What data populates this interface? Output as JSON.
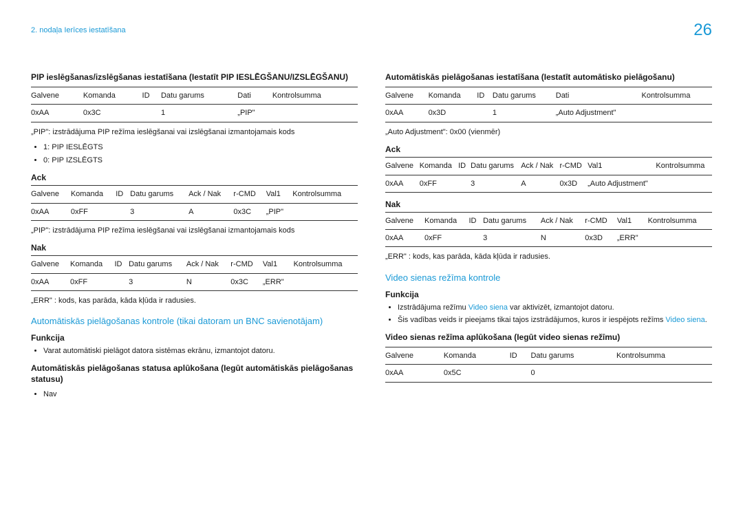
{
  "header": {
    "breadcrumb": "2. nodaļa Ierīces iestatīšana",
    "page": "26"
  },
  "left": {
    "sec1_title": "PIP ieslēgšanas/izslēgšanas iestatīšana (Iestatīt PIP IESLĒGŠANU/IZSLĒGŠANU)",
    "t1": {
      "h": [
        "Galvene",
        "Komanda",
        "ID",
        "Datu garums",
        "Dati",
        "Kontrolsumma"
      ],
      "r": [
        "0xAA",
        "0x3C",
        "",
        "1",
        "„PIP\"",
        ""
      ]
    },
    "note1": "„PIP\": izstrādājuma PIP režīma ieslēgšanai vai izslēgšanai izmantojamais kods",
    "b1": [
      "1: PIP IESLĒGTS",
      "0: PIP IZSLĒGTS"
    ],
    "ack_label": "Ack",
    "t2": {
      "h": [
        "Galvene",
        "Komanda",
        "ID",
        "Datu garums",
        "Ack / Nak",
        "r-CMD",
        "Val1",
        "Kontrolsumma"
      ],
      "r": [
        "0xAA",
        "0xFF",
        "",
        "3",
        "A",
        "0x3C",
        "„PIP\"",
        ""
      ]
    },
    "note2": "„PIP\": izstrādājuma PIP režīma ieslēgšanai vai izslēgšanai izmantojamais kods",
    "nak_label": "Nak",
    "t3": {
      "h": [
        "Galvene",
        "Komanda",
        "ID",
        "Datu garums",
        "Ack / Nak",
        "r-CMD",
        "Val1",
        "Kontrolsumma"
      ],
      "r": [
        "0xAA",
        "0xFF",
        "",
        "3",
        "N",
        "0x3C",
        "„ERR\"",
        ""
      ]
    },
    "note3": "„ERR\" : kods, kas parāda, kāda kļūda ir radusies.",
    "sec2_title": "Automātiskās pielāgošanas kontrole (tikai datoram un BNC savienotājam)",
    "funkcija_label": "Funkcija",
    "b2": [
      "Varat automātiski pielāgot datora sistēmas ekrānu, izmantojot datoru."
    ],
    "sec3_title": "Automātiskās pielāgošanas statusa aplūkošana (Iegūt automātiskās pielāgošanas statusu)",
    "b3": [
      "Nav"
    ]
  },
  "right": {
    "sec1_title": "Automātiskās pielāgošanas iestatīšana (Iestatīt automātisko pielāgošanu)",
    "t1": {
      "h": [
        "Galvene",
        "Komanda",
        "ID",
        "Datu garums",
        "Dati",
        "Kontrolsumma"
      ],
      "r": [
        "0xAA",
        "0x3D",
        "",
        "1",
        "„Auto Adjustment\"",
        ""
      ]
    },
    "note1": "„Auto Adjustment\": 0x00 (vienmēr)",
    "ack_label": "Ack",
    "t2": {
      "h": [
        "Galvene",
        "Komanda",
        "ID",
        "Datu garums",
        "Ack / Nak",
        "r-CMD",
        "Val1",
        "Kontrolsumma"
      ],
      "r": [
        "0xAA",
        "0xFF",
        "",
        "3",
        "A",
        "0x3D",
        "„Auto Adjustment\"",
        ""
      ]
    },
    "nak_label": "Nak",
    "t3": {
      "h": [
        "Galvene",
        "Komanda",
        "ID",
        "Datu garums",
        "Ack / Nak",
        "r-CMD",
        "Val1",
        "Kontrolsumma"
      ],
      "r": [
        "0xAA",
        "0xFF",
        "",
        "3",
        "N",
        "0x3D",
        "„ERR\"",
        ""
      ]
    },
    "note3": "„ERR\" : kods, kas parāda, kāda kļūda ir radusies.",
    "sec2_title": "Video sienas režīma kontrole",
    "funkcija_label": "Funkcija",
    "b2_pre": "Izstrādājuma režīmu ",
    "b2_link": "Video siena",
    "b2_post": " var aktivizēt, izmantojot datoru.",
    "b3_pre": "Šis vadības veids ir pieejams tikai tajos izstrādājumos, kuros ir iespējots režīms ",
    "b3_link": "Video siena",
    "b3_post": ".",
    "sec3_title": "Video sienas režīma aplūkošana (Iegūt video sienas režīmu)",
    "t4": {
      "h": [
        "Galvene",
        "Komanda",
        "ID",
        "Datu garums",
        "Kontrolsumma"
      ],
      "r": [
        "0xAA",
        "0x5C",
        "",
        "0",
        ""
      ]
    }
  }
}
